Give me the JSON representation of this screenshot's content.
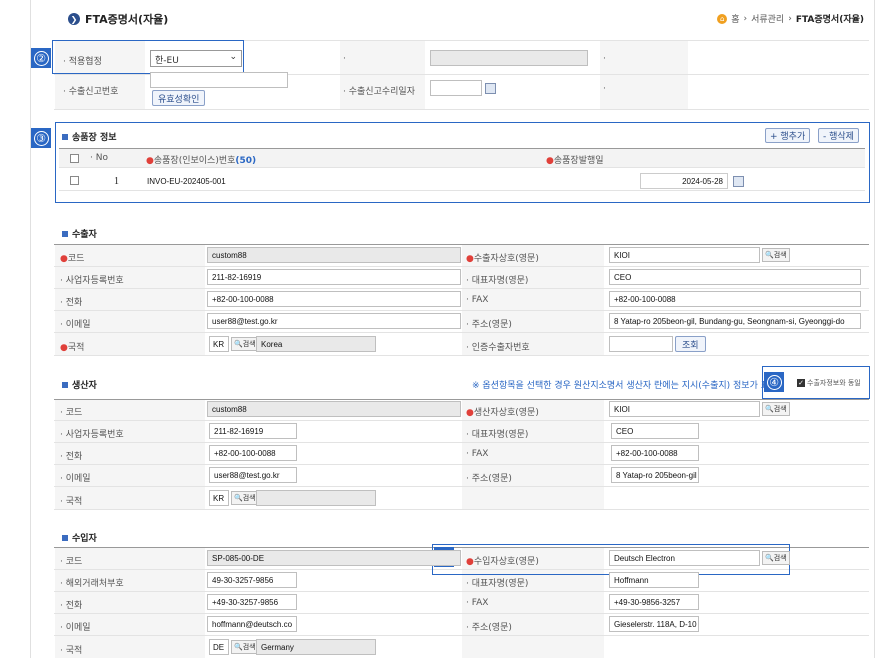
{
  "header": {
    "title": "FTA증명서(자율)",
    "breadcrumb": [
      "홈",
      "서류관리",
      "FTA증명서(자율)"
    ]
  },
  "top": {
    "agreement_label": "적용협정",
    "agreement_value": "한-EU",
    "export_no_label": "수출신고번호",
    "validity_button": "유효성확인",
    "accept_date_label": "수출신고수리일자"
  },
  "invoice": {
    "title": "송품장 정보",
    "add_row": "+ 행추가",
    "del_row": "- 행삭제",
    "col_no": "No",
    "col_invoice": "송품장(인보이스)번호",
    "col_invoice_count": "(50)",
    "col_date": "송품장발행일",
    "rows": [
      {
        "no": "1",
        "invoice": "INVO-EU-202405-001",
        "date": "2024-05-28"
      }
    ]
  },
  "exporter": {
    "title": "수출자",
    "code_label": "코드",
    "code": "custom88",
    "name_label": "수출자상호(영문)",
    "name": "KIOI",
    "bizno_label": "사업자등록번호",
    "bizno": "211-82-16919",
    "rep_label": "대표자명(영문)",
    "rep": "CEO",
    "tel_label": "전화",
    "tel": "+82-00-100-0088",
    "fax_label": "FAX",
    "fax": "+82-00-100-0088",
    "email_label": "이메일",
    "email": "user88@test.go.kr",
    "addr_label": "주소(영문)",
    "addr": "8 Yatap-ro 205beon-gil, Bundang-gu, Seongnam-si, Gyeonggi-do",
    "country_label": "국적",
    "country_code": "KR",
    "country_name": "Korea",
    "cert_label": "인증수출자번호",
    "lookup": "조회"
  },
  "producer": {
    "title": "생산자",
    "note": "※ 옵션항목을 선택한 경우 원산지소명서 생산자 란에는 지시(수출지) 정보가 표",
    "same_label": "수출자정보와 동일",
    "code_label": "코드",
    "code": "custom88",
    "name_label": "생산자상호(영문)",
    "name": "KIOI",
    "bizno_label": "사업자등록번호",
    "bizno": "211-82-16919",
    "rep_label": "대표자명(영문)",
    "rep": "CEO",
    "tel_label": "전화",
    "tel": "+82-00-100-0088",
    "fax_label": "FAX",
    "fax": "+82-00-100-0088",
    "email_label": "이메일",
    "email": "user88@test.go.kr",
    "addr_label": "주소(영문)",
    "addr": "8 Yatap-ro 205beon-gil",
    "country_label": "국적",
    "country_code": "KR"
  },
  "importer": {
    "title": "수입자",
    "code_label": "코드",
    "code": "SP-085-00-DE",
    "name_label": "수입자상호(영문)",
    "name": "Deutsch Electron",
    "foreign_label": "해외거래처부호",
    "foreign": "49-30-3257-9856",
    "rep_label": "대표자명(영문)",
    "rep": "Hoffmann",
    "tel_label": "전화",
    "tel": "+49-30-3257-9856",
    "fax_label": "FAX",
    "fax": "+49-30-9856-3257",
    "email_label": "이메일",
    "email": "hoffmann@deutsch.co",
    "addr_label": "주소(영문)",
    "addr": "Gieselerstr. 118A, D-10",
    "country_label": "국적",
    "country_code": "DE",
    "country_name": "Germany"
  },
  "search_label": "검색",
  "callouts": {
    "c2": "②",
    "c3": "③",
    "c4": "④",
    "c5": "⑤"
  },
  "colors": {
    "accent": "#2a67c4",
    "required": "#e0403a"
  }
}
